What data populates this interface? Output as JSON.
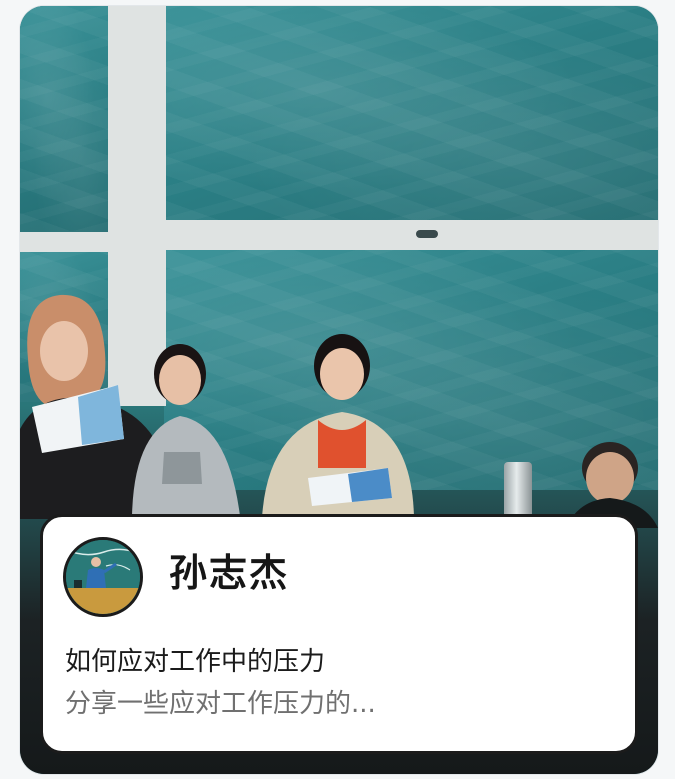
{
  "post": {
    "author_name": "孙志杰",
    "title": "如何应对工作中的压力",
    "excerpt": "分享一些应对工作压力的..."
  },
  "colors": {
    "card_border": "#1b1b1b",
    "chalkboard": "#2b7f85",
    "excerpt_text": "#707070"
  },
  "icons": {
    "avatar": "avatar-image"
  }
}
